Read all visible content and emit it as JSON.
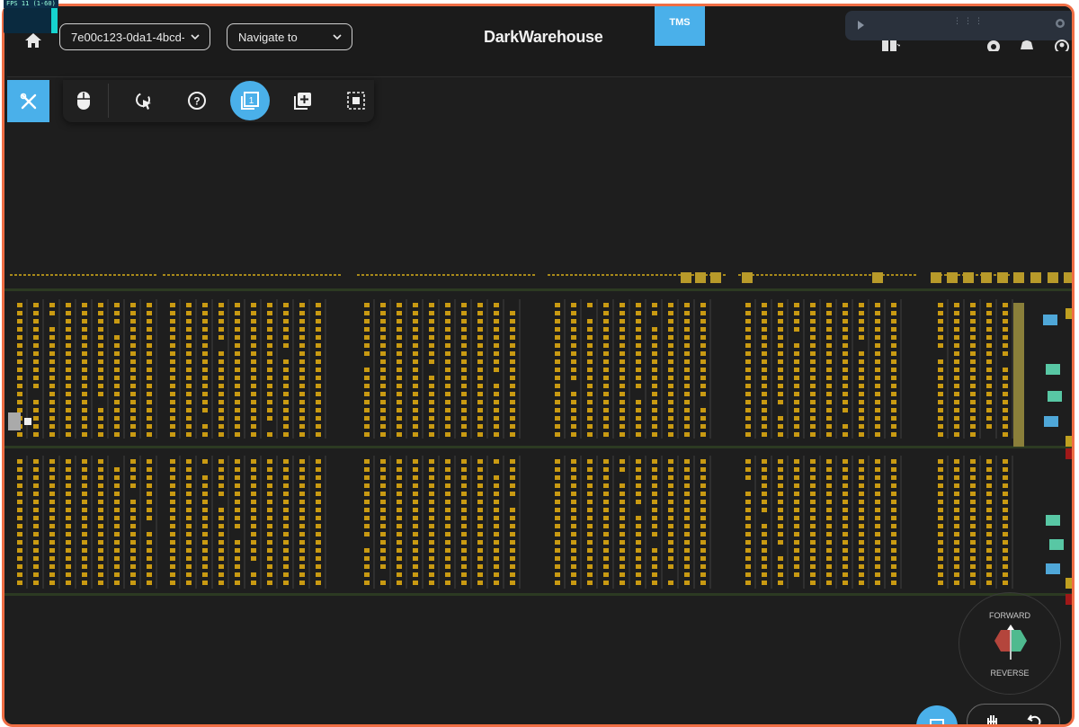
{
  "fps_text": "FPS 11 (1-60)",
  "header": {
    "warehouse_select": "7e00c123-0da1-4bcd-8...",
    "navigate_select": "Navigate to",
    "brand": "DarkWarehouse",
    "tms_label": "TMS"
  },
  "icons": {
    "home": "home-icon",
    "warehouse_chevron": "chevron-down-icon",
    "navigate_chevron": "chevron-down-icon",
    "play": "play-icon",
    "drag": "drag-handle-icon",
    "zoom": "zoom-icon",
    "layout": "layout-icon",
    "settings": "gear-icon",
    "notifications": "bell-icon",
    "account": "account-icon"
  },
  "toolbar": {
    "main": "tools-icon",
    "buttons": [
      {
        "name": "mouse-mode-icon",
        "active": false
      },
      {
        "name": "pointer-select-icon",
        "active": false
      },
      {
        "name": "help-icon",
        "active": false
      },
      {
        "name": "single-view-icon",
        "active": true
      },
      {
        "name": "add-layer-icon",
        "active": false
      },
      {
        "name": "select-area-icon",
        "active": false
      }
    ]
  },
  "direction": {
    "forward": "FORWARD",
    "reverse": "REVERSE"
  },
  "bottom_controls": {
    "fab": "square-icon",
    "pan": "hand-icon",
    "rotate": "undo-icon"
  },
  "colors": {
    "accent": "#4ab0ea",
    "frame": "#f06e45",
    "background": "#1e1e1e",
    "storage_slot": "#c99a12",
    "forward_arrow": "#4fba8f",
    "reverse_arrow": "#b4453c"
  }
}
